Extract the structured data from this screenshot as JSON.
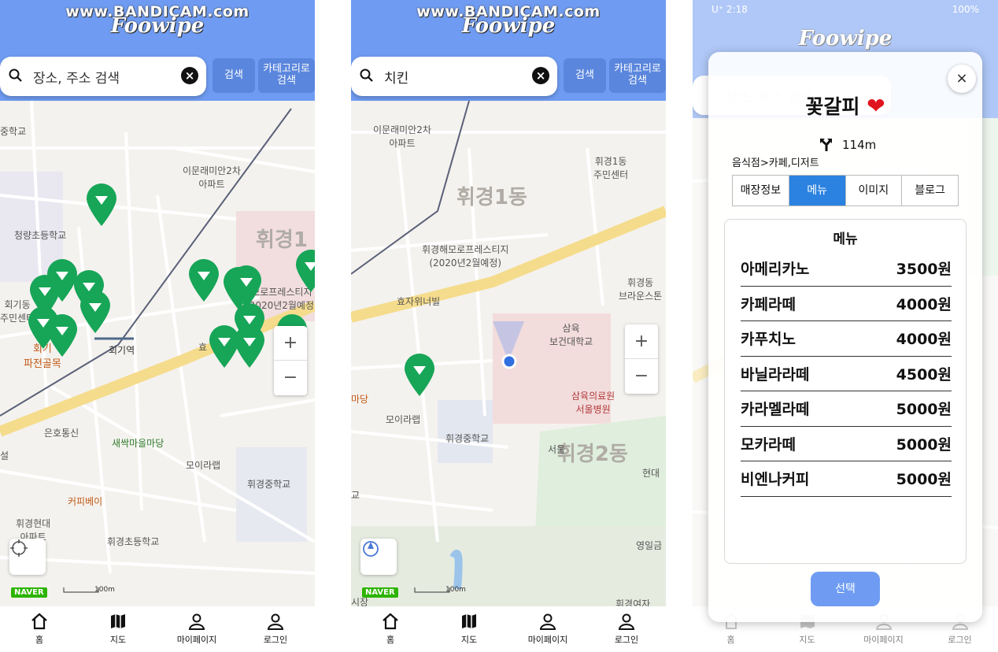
{
  "watermark": "www.BANDICAM.com",
  "app": {
    "logo": "Foowipe"
  },
  "search": {
    "placeholder": "장소, 주소 검색",
    "query_screen2": "치킨",
    "search_button": "검색",
    "category_button_line1": "카테고리로",
    "category_button_line2": "검색",
    "clear_icon": "×"
  },
  "nav": {
    "items": [
      {
        "label": "홈",
        "icon": "home-icon"
      },
      {
        "label": "지도",
        "icon": "map-icon"
      },
      {
        "label": "마이페이지",
        "icon": "user-icon"
      },
      {
        "label": "로그인",
        "icon": "user-icon"
      }
    ]
  },
  "map1": {
    "labels": {
      "school1": "중학교",
      "apt1_line1": "이문래미안2차",
      "apt1_line2": "아파트",
      "school2": "청량초등학교",
      "district": "휘경1",
      "dong_center_line1": "회기동",
      "dong_center_line2": "주민센터",
      "station": "회기역",
      "alley_line1": "회기",
      "alley_line2": "파전골목",
      "apt2_part": "모로프레스티지",
      "apt2_date": "(2020년2월예정)",
      "hyo": "효",
      "eunho": "은호통신",
      "saessak": "새싹마을마당",
      "seol": "설",
      "moira": "모이라랩",
      "hwigyeong_ms": "휘경중학교",
      "coffeebay": "커피베이",
      "hyundai_line1": "휘경현대",
      "hyundai_line2": "아파트",
      "hwigyeong_es": "휘경초등학교"
    },
    "naver": "NAVER",
    "scale": "100m",
    "zoom_in": "+",
    "zoom_out": "−"
  },
  "map2": {
    "labels": {
      "apt1_line1": "이문래미안2차",
      "apt1_line2": "아파트",
      "center_line1": "휘경1동",
      "center_line2": "주민센터",
      "district1": "휘경1동",
      "apt2_line1": "휘경해모로프레스티지",
      "apt2_line2": "(2020년2월예정)",
      "hyoja": "효자위너빌",
      "brown_line1": "휘경동",
      "brown_line2": "브라운스톤",
      "univ_line1": "삼육",
      "univ_line2": "보건대학교",
      "hosp_line1": "삼육의료원",
      "hosp_line2": "서울병원",
      "madang": "마당",
      "moira": "모이라랩",
      "hwigyeong_ms": "휘경중학교",
      "district2": "휘경2동",
      "seoul_part": "서울",
      "hyundai": "현대",
      "gyo": "교",
      "youngil": "영일금",
      "market": "시장",
      "hwigyeong_yeo": "휘경여자"
    },
    "naver": "NAVER",
    "scale": "100m",
    "zoom_in": "+",
    "zoom_out": "−"
  },
  "statusbar": {
    "left": "U⁺ 2:18",
    "right": "100%"
  },
  "detail": {
    "store_name": "꽃갈피",
    "distance": "114m",
    "category": "음식점>카페,디저트",
    "tabs": [
      "매장정보",
      "메뉴",
      "이미지",
      "블로그"
    ],
    "active_tab": "메뉴",
    "menu_title": "메뉴",
    "menu": [
      {
        "name": "아메리카노",
        "price": "3500원"
      },
      {
        "name": "카페라떼",
        "price": "4000원"
      },
      {
        "name": "카푸치노",
        "price": "4000원"
      },
      {
        "name": "바닐라라떼",
        "price": "4500원"
      },
      {
        "name": "카라멜라떼",
        "price": "5000원"
      },
      {
        "name": "모카라떼",
        "price": "5000원"
      },
      {
        "name": "비엔나커피",
        "price": "5000원"
      }
    ],
    "select_button": "선택",
    "close_icon": "×"
  },
  "colors": {
    "header": "#6f9cf2",
    "button": "#5a86dd",
    "pin": "#17a558",
    "active_tab": "#2b82e0",
    "heart": "#e0141e"
  }
}
